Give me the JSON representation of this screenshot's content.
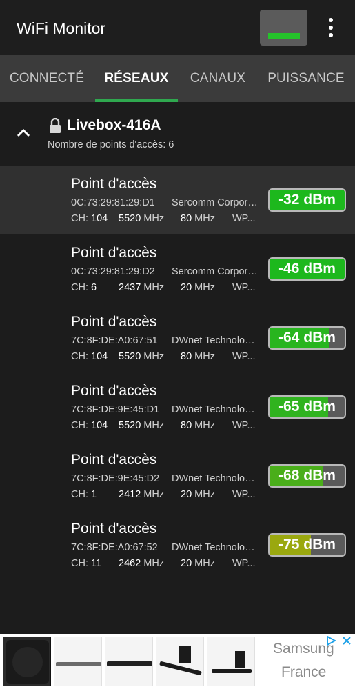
{
  "appbar": {
    "title": "WiFi Monitor",
    "signal_icon": "signal-bar-icon",
    "menu_icon": "more-vert-icon"
  },
  "tabs": [
    {
      "label": "CONNECTÉ",
      "active": false
    },
    {
      "label": "RÉSEAUX",
      "active": true
    },
    {
      "label": "CANAUX",
      "active": false
    },
    {
      "label": "PUISSANCE",
      "active": false
    }
  ],
  "network": {
    "ssid": "Livebox-416A",
    "ap_count": "Nombre de points d'accès: 6"
  },
  "units": {
    "ch": "CH: ",
    "mhz": " MHz"
  },
  "access_points": [
    {
      "name": "Point d'accès",
      "mac": "0C:73:29:81:29:D1",
      "vendor": "Sercomm Corporation",
      "channel": "104",
      "freq": "5520",
      "width": "80",
      "security": "WP...",
      "signal": "-32 dBm",
      "level": 1.0,
      "color": "#1db81d"
    },
    {
      "name": "Point d'accès",
      "mac": "0C:73:29:81:29:D2",
      "vendor": "Sercomm Corporation",
      "channel": "6",
      "freq": "2437",
      "width": "20",
      "security": "WP...",
      "signal": "-46 dBm",
      "level": 1.0,
      "color": "#1db81d"
    },
    {
      "name": "Point d'accès",
      "mac": "7C:8F:DE:A0:67:51",
      "vendor": "DWnet Technologies",
      "channel": "104",
      "freq": "5520",
      "width": "80",
      "security": "WP...",
      "signal": "-64 dBm",
      "level": 0.8,
      "color": "#28b51f"
    },
    {
      "name": "Point d'accès",
      "mac": "7C:8F:DE:9E:45:D1",
      "vendor": "DWnet Technologies",
      "channel": "104",
      "freq": "5520",
      "width": "80",
      "security": "WP...",
      "signal": "-65 dBm",
      "level": 0.78,
      "color": "#30b31f"
    },
    {
      "name": "Point d'accès",
      "mac": "7C:8F:DE:9E:45:D2",
      "vendor": "DWnet Technologies",
      "channel": "1",
      "freq": "2412",
      "width": "20",
      "security": "WP...",
      "signal": "-68 dBm",
      "level": 0.72,
      "color": "#4aae1a"
    },
    {
      "name": "Point d'accès",
      "mac": "7C:8F:DE:A0:67:52",
      "vendor": "DWnet Technologies",
      "channel": "11",
      "freq": "2462",
      "width": "20",
      "security": "WP...",
      "signal": "-75 dBm",
      "level": 0.55,
      "color": "#9aa80f"
    }
  ],
  "ad": {
    "brand": "Samsung",
    "country": "France",
    "play_icon": "ad-choices-icon",
    "close_icon": "close-icon"
  }
}
